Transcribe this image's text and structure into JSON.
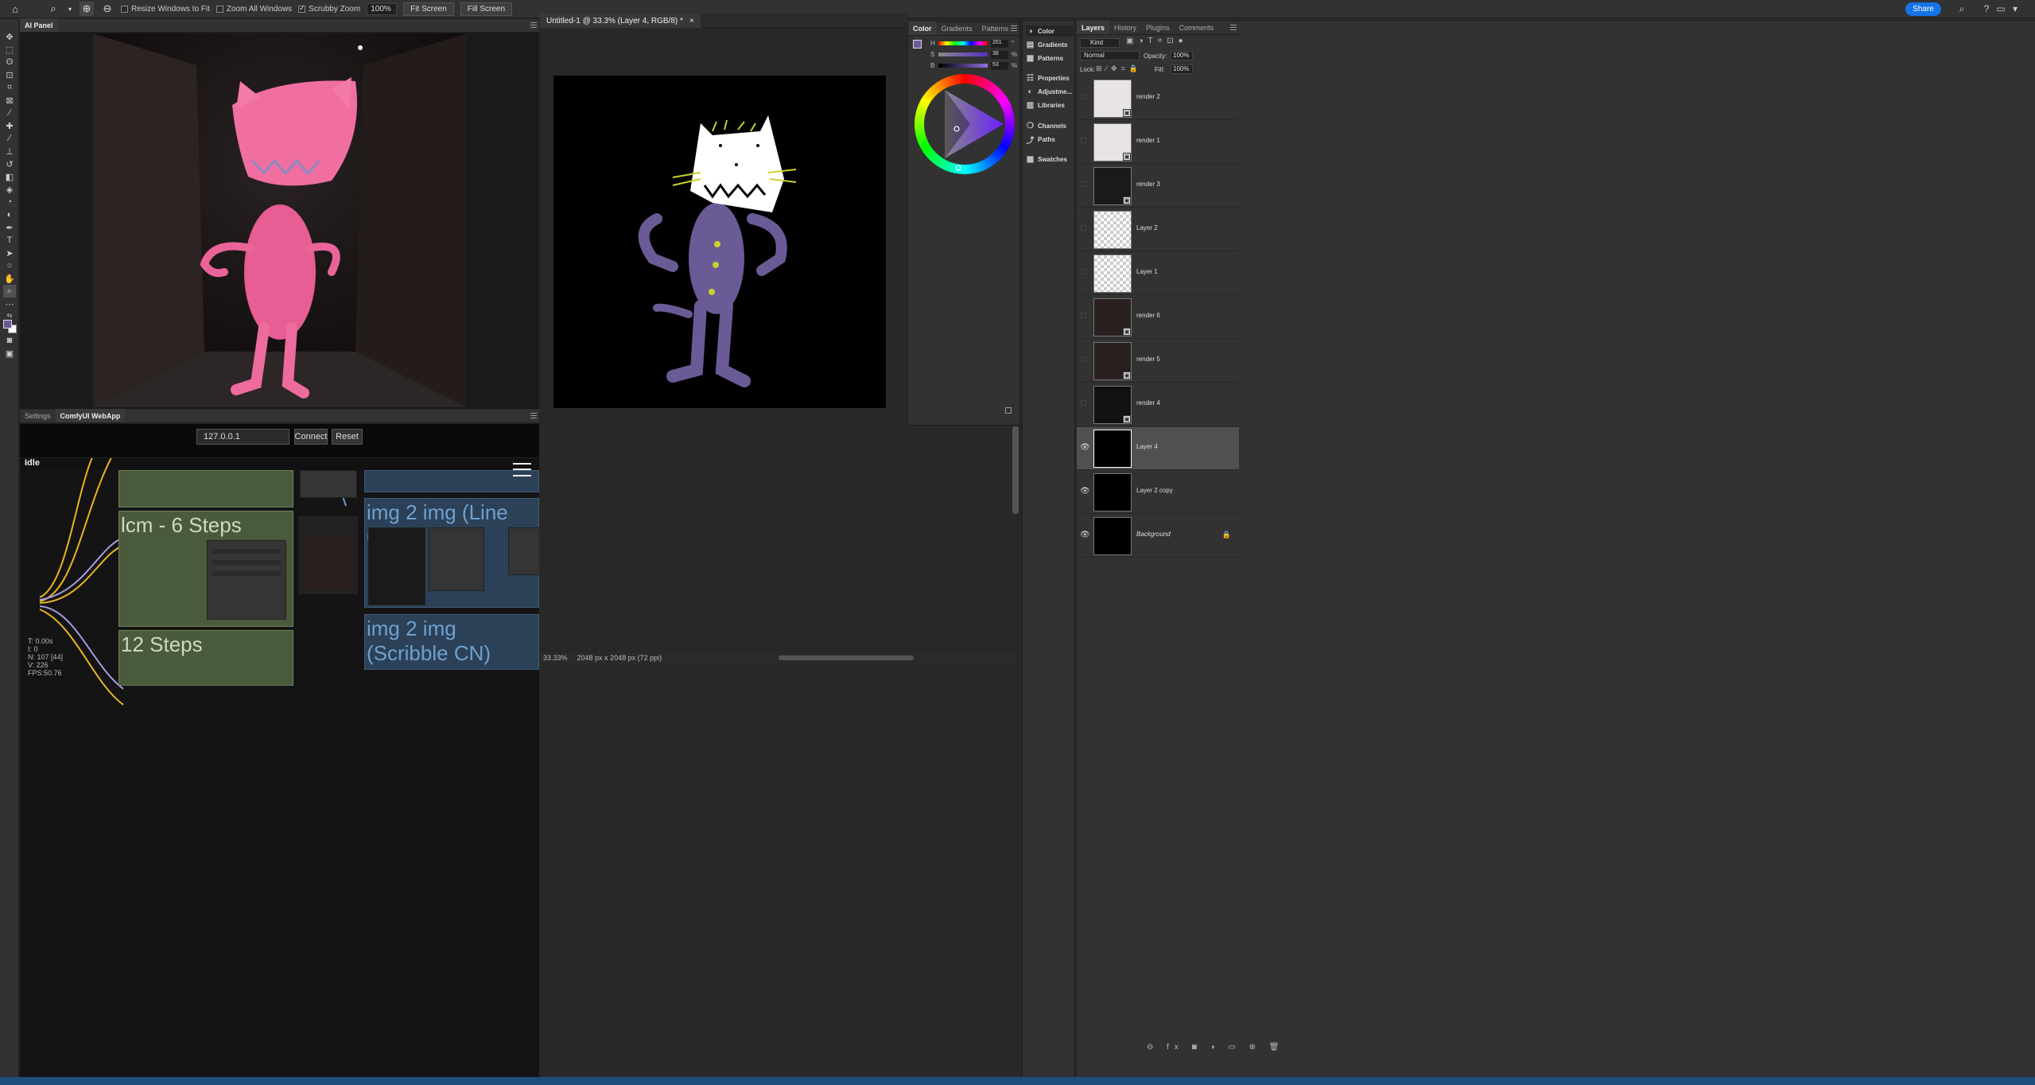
{
  "optionsbar": {
    "resize_windows": "Resize Windows to Fit",
    "zoom_all": "Zoom All Windows",
    "scrubby": "Scrubby Zoom",
    "zoom_value": "100%",
    "fit_screen": "Fit Screen",
    "fill_screen": "Fill Screen",
    "share": "Share"
  },
  "ai_panel": {
    "tab": "AI Panel"
  },
  "comfy": {
    "tabs": [
      "Settings",
      "ComfyUI WebApp"
    ],
    "host": "127.0.0.1",
    "connect": "Connect",
    "reset": "Reset",
    "status": "Idle",
    "groups": {
      "lcm": "lcm - 6 Steps",
      "steps12": "12 Steps",
      "line_cn": "img 2 img (Line CN)",
      "scribble_cn": "img 2 img (Scribble CN)"
    },
    "stats": [
      "T: 0.00s",
      "I: 0",
      "N: 107 [44]",
      "V: 226",
      "FPS:50.76"
    ]
  },
  "document": {
    "tab_title": "Untitled-1 @ 33.3% (Layer 4, RGB/8) *",
    "zoom": "33.33%",
    "dimensions": "2048 px x 2048 px (72 ppi)"
  },
  "color_panel": {
    "tabs": [
      "Color",
      "Gradients",
      "Patterns"
    ],
    "h": {
      "label": "H",
      "value": "261",
      "unit": "°"
    },
    "s": {
      "label": "S",
      "value": "38",
      "unit": "%"
    },
    "b": {
      "label": "B",
      "value": "53",
      "unit": "%"
    },
    "foreground_color": "#6a5a95"
  },
  "side_panel": {
    "items": [
      "Color",
      "Gradients",
      "Patterns",
      "Properties",
      "Adjustme...",
      "Libraries",
      "Channels",
      "Paths",
      "Swatches"
    ]
  },
  "layers_panel": {
    "tabs": [
      "Layers",
      "History",
      "Plugins",
      "Comments"
    ],
    "filter": "Kind",
    "blend_mode": "Normal",
    "opacity_label": "Opacity:",
    "opacity": "100%",
    "lock_label": "Lock:",
    "fill_label": "Fill:",
    "fill": "100%",
    "layers": [
      {
        "name": "render 2",
        "visible": false
      },
      {
        "name": "render 1",
        "visible": false
      },
      {
        "name": "render 3",
        "visible": false
      },
      {
        "name": "Layer 2",
        "visible": false
      },
      {
        "name": "Layer 1",
        "visible": false
      },
      {
        "name": "render 6",
        "visible": false
      },
      {
        "name": "render 5",
        "visible": false
      },
      {
        "name": "render 4",
        "visible": false
      },
      {
        "name": "Layer 4",
        "visible": true,
        "selected": true
      },
      {
        "name": "Layer 2 copy",
        "visible": true
      },
      {
        "name": "Background",
        "visible": true,
        "locked": true
      }
    ]
  }
}
